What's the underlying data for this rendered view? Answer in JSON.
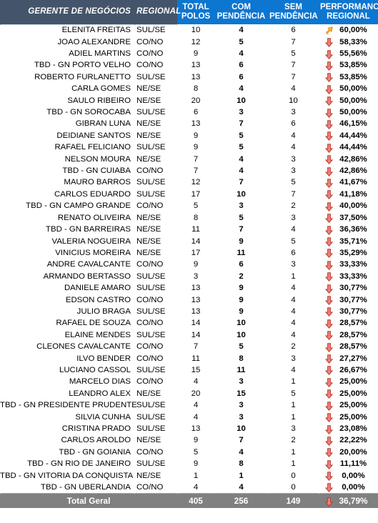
{
  "table": {
    "header": {
      "col_name": "GERENTE DE NEGÓCIOS",
      "col_regional": "REGIONAL",
      "col_total_line1": "TOTAL",
      "col_total_line2": "POLOS",
      "col_com_line1": "COM",
      "col_com_line2": "PENDÊNCIA",
      "col_sem_line1": "SEM",
      "col_sem_line2": "PENDÊNCIA",
      "col_perf_line1": "PERFORMANCE",
      "col_perf_line2": "REGIONAL"
    },
    "colors": {
      "header_dark": "#44546a",
      "header_blue": "#0d76d0",
      "total_row": "#808080",
      "arrow_down": "#d93b3b",
      "arrow_up_right": "#f0a21e"
    },
    "rows": [
      {
        "name": "ELENITA FREITAS",
        "regional": "SUL/SE",
        "total": "10",
        "com": "4",
        "sem": "6",
        "icon": "arrow-up-right-icon",
        "perf": "60,00%"
      },
      {
        "name": "JOAO ALEXANDRE",
        "regional": "CO/NO",
        "total": "12",
        "com": "5",
        "sem": "7",
        "icon": "arrow-down-icon",
        "perf": "58,33%"
      },
      {
        "name": "ADIEL MARTINS",
        "regional": "CO/NO",
        "total": "9",
        "com": "4",
        "sem": "5",
        "icon": "arrow-down-icon",
        "perf": "55,56%"
      },
      {
        "name": "TBD - GN PORTO VELHO",
        "regional": "CO/NO",
        "total": "13",
        "com": "6",
        "sem": "7",
        "icon": "arrow-down-icon",
        "perf": "53,85%"
      },
      {
        "name": "ROBERTO FURLANETTO",
        "regional": "SUL/SE",
        "total": "13",
        "com": "6",
        "sem": "7",
        "icon": "arrow-down-icon",
        "perf": "53,85%"
      },
      {
        "name": "CARLA GOMES",
        "regional": "NE/SE",
        "total": "8",
        "com": "4",
        "sem": "4",
        "icon": "arrow-down-icon",
        "perf": "50,00%"
      },
      {
        "name": "SAULO RIBEIRO",
        "regional": "NE/SE",
        "total": "20",
        "com": "10",
        "sem": "10",
        "icon": "arrow-down-icon",
        "perf": "50,00%"
      },
      {
        "name": "TBD - GN SOROCABA",
        "regional": "SUL/SE",
        "total": "6",
        "com": "3",
        "sem": "3",
        "icon": "arrow-down-icon",
        "perf": "50,00%"
      },
      {
        "name": "GIBRAN LUNA",
        "regional": "NE/SE",
        "total": "13",
        "com": "7",
        "sem": "6",
        "icon": "arrow-down-icon",
        "perf": "46,15%"
      },
      {
        "name": "DEIDIANE SANTOS",
        "regional": "NE/SE",
        "total": "9",
        "com": "5",
        "sem": "4",
        "icon": "arrow-down-icon",
        "perf": "44,44%"
      },
      {
        "name": "RAFAEL FELICIANO",
        "regional": "SUL/SE",
        "total": "9",
        "com": "5",
        "sem": "4",
        "icon": "arrow-down-icon",
        "perf": "44,44%"
      },
      {
        "name": "NELSON MOURA",
        "regional": "NE/SE",
        "total": "7",
        "com": "4",
        "sem": "3",
        "icon": "arrow-down-icon",
        "perf": "42,86%"
      },
      {
        "name": "TBD - GN CUIABA",
        "regional": "CO/NO",
        "total": "7",
        "com": "4",
        "sem": "3",
        "icon": "arrow-down-icon",
        "perf": "42,86%"
      },
      {
        "name": "MAURO BARROS",
        "regional": "SUL/SE",
        "total": "12",
        "com": "7",
        "sem": "5",
        "icon": "arrow-down-icon",
        "perf": "41,67%"
      },
      {
        "name": "CARLOS EDUARDO",
        "regional": "SUL/SE",
        "total": "17",
        "com": "10",
        "sem": "7",
        "icon": "arrow-down-icon",
        "perf": "41,18%"
      },
      {
        "name": "TBD - GN CAMPO GRANDE",
        "regional": "CO/NO",
        "total": "5",
        "com": "3",
        "sem": "2",
        "icon": "arrow-down-icon",
        "perf": "40,00%"
      },
      {
        "name": "RENATO OLIVEIRA",
        "regional": "NE/SE",
        "total": "8",
        "com": "5",
        "sem": "3",
        "icon": "arrow-down-icon",
        "perf": "37,50%"
      },
      {
        "name": "TBD - GN BARREIRAS",
        "regional": "NE/SE",
        "total": "11",
        "com": "7",
        "sem": "4",
        "icon": "arrow-down-icon",
        "perf": "36,36%"
      },
      {
        "name": "VALERIA NOGUEIRA",
        "regional": "NE/SE",
        "total": "14",
        "com": "9",
        "sem": "5",
        "icon": "arrow-down-icon",
        "perf": "35,71%"
      },
      {
        "name": "VINICIUS MOREIRA",
        "regional": "NE/SE",
        "total": "17",
        "com": "11",
        "sem": "6",
        "icon": "arrow-down-icon",
        "perf": "35,29%"
      },
      {
        "name": "ANDRE CAVALCANTE",
        "regional": "CO/NO",
        "total": "9",
        "com": "6",
        "sem": "3",
        "icon": "arrow-down-icon",
        "perf": "33,33%"
      },
      {
        "name": "ARMANDO BERTASSO",
        "regional": "SUL/SE",
        "total": "3",
        "com": "2",
        "sem": "1",
        "icon": "arrow-down-icon",
        "perf": "33,33%"
      },
      {
        "name": "DANIELE AMARO",
        "regional": "SUL/SE",
        "total": "13",
        "com": "9",
        "sem": "4",
        "icon": "arrow-down-icon",
        "perf": "30,77%"
      },
      {
        "name": "EDSON CASTRO",
        "regional": "CO/NO",
        "total": "13",
        "com": "9",
        "sem": "4",
        "icon": "arrow-down-icon",
        "perf": "30,77%"
      },
      {
        "name": "JULIO BRAGA",
        "regional": "SUL/SE",
        "total": "13",
        "com": "9",
        "sem": "4",
        "icon": "arrow-down-icon",
        "perf": "30,77%"
      },
      {
        "name": "RAFAEL DE SOUZA",
        "regional": "CO/NO",
        "total": "14",
        "com": "10",
        "sem": "4",
        "icon": "arrow-down-icon",
        "perf": "28,57%"
      },
      {
        "name": "ELAINE MENDES",
        "regional": "SUL/SE",
        "total": "14",
        "com": "10",
        "sem": "4",
        "icon": "arrow-down-icon",
        "perf": "28,57%"
      },
      {
        "name": "CLEONES CAVALCANTE",
        "regional": "CO/NO",
        "total": "7",
        "com": "5",
        "sem": "2",
        "icon": "arrow-down-icon",
        "perf": "28,57%"
      },
      {
        "name": "ILVO BENDER",
        "regional": "CO/NO",
        "total": "11",
        "com": "8",
        "sem": "3",
        "icon": "arrow-down-icon",
        "perf": "27,27%"
      },
      {
        "name": "LUCIANO CASSOL",
        "regional": "SUL/SE",
        "total": "15",
        "com": "11",
        "sem": "4",
        "icon": "arrow-down-icon",
        "perf": "26,67%"
      },
      {
        "name": "MARCELO DIAS",
        "regional": "CO/NO",
        "total": "4",
        "com": "3",
        "sem": "1",
        "icon": "arrow-down-icon",
        "perf": "25,00%"
      },
      {
        "name": "LEANDRO ALEX",
        "regional": "NE/SE",
        "total": "20",
        "com": "15",
        "sem": "5",
        "icon": "arrow-down-icon",
        "perf": "25,00%"
      },
      {
        "name": "TBD - GN PRESIDENTE PRUDENTE",
        "regional": "SUL/SE",
        "total": "4",
        "com": "3",
        "sem": "1",
        "icon": "arrow-down-icon",
        "perf": "25,00%"
      },
      {
        "name": "SILVIA CUNHA",
        "regional": "SUL/SE",
        "total": "4",
        "com": "3",
        "sem": "1",
        "icon": "arrow-down-icon",
        "perf": "25,00%"
      },
      {
        "name": "CRISTINA PRADO",
        "regional": "SUL/SE",
        "total": "13",
        "com": "10",
        "sem": "3",
        "icon": "arrow-down-icon",
        "perf": "23,08%"
      },
      {
        "name": "CARLOS AROLDO",
        "regional": "NE/SE",
        "total": "9",
        "com": "7",
        "sem": "2",
        "icon": "arrow-down-icon",
        "perf": "22,22%"
      },
      {
        "name": "TBD - GN GOIANIA",
        "regional": "CO/NO",
        "total": "5",
        "com": "4",
        "sem": "1",
        "icon": "arrow-down-icon",
        "perf": "20,00%"
      },
      {
        "name": "TBD - GN RIO DE JANEIRO",
        "regional": "SUL/SE",
        "total": "9",
        "com": "8",
        "sem": "1",
        "icon": "arrow-down-icon",
        "perf": "11,11%"
      },
      {
        "name": "TBD - GN VITORIA DA CONQUISTA",
        "regional": "NE/SE",
        "total": "1",
        "com": "1",
        "sem": "0",
        "icon": "arrow-down-icon",
        "perf": "0,00%"
      },
      {
        "name": "TBD - GN UBERLANDIA",
        "regional": "CO/NO",
        "total": "4",
        "com": "4",
        "sem": "0",
        "icon": "arrow-down-icon",
        "perf": "0,00%"
      }
    ],
    "total_row": {
      "label": "Total Geral",
      "total": "405",
      "com": "256",
      "sem": "149",
      "icon": "arrow-down-icon",
      "perf": "36,79%"
    }
  }
}
